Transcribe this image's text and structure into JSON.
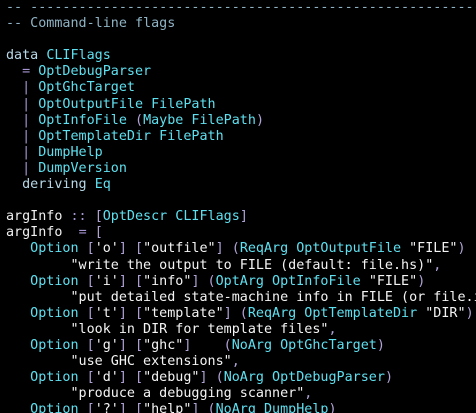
{
  "editor": {
    "lines": [
      [
        {
          "t": "-- ---------------------------------------------------------",
          "c": "comment"
        }
      ],
      [
        {
          "t": "-- Command-line flags",
          "c": "comment"
        }
      ],
      [],
      [
        {
          "t": "data ",
          "c": "keyword"
        },
        {
          "t": "CLIFlags",
          "c": "type"
        }
      ],
      [
        {
          "t": "  = ",
          "c": "oper"
        },
        {
          "t": "OptDebugParser",
          "c": "type"
        }
      ],
      [
        {
          "t": "  | ",
          "c": "oper"
        },
        {
          "t": "OptGhcTarget",
          "c": "type"
        }
      ],
      [
        {
          "t": "  | ",
          "c": "oper"
        },
        {
          "t": "OptOutputFile FilePath",
          "c": "type"
        }
      ],
      [
        {
          "t": "  | ",
          "c": "oper"
        },
        {
          "t": "OptInfoFile ",
          "c": "type"
        },
        {
          "t": "(",
          "c": "punct"
        },
        {
          "t": "Maybe FilePath",
          "c": "type"
        },
        {
          "t": ")",
          "c": "punct"
        }
      ],
      [
        {
          "t": "  | ",
          "c": "oper"
        },
        {
          "t": "OptTemplateDir FilePath",
          "c": "type"
        }
      ],
      [
        {
          "t": "  | ",
          "c": "oper"
        },
        {
          "t": "DumpHelp",
          "c": "type"
        }
      ],
      [
        {
          "t": "  | ",
          "c": "oper"
        },
        {
          "t": "DumpVersion",
          "c": "type"
        }
      ],
      [
        {
          "t": "  deriving ",
          "c": "keyword"
        },
        {
          "t": "Eq",
          "c": "type"
        }
      ],
      [],
      [
        {
          "t": "argInfo ",
          "c": "plain"
        },
        {
          "t": ":: ",
          "c": "oper"
        },
        {
          "t": "[",
          "c": "punct"
        },
        {
          "t": "OptDescr CLIFlags",
          "c": "type"
        },
        {
          "t": "]",
          "c": "punct"
        }
      ],
      [
        {
          "t": "argInfo  ",
          "c": "plain"
        },
        {
          "t": "= ",
          "c": "oper"
        },
        {
          "t": "[",
          "c": "punct"
        }
      ],
      [
        {
          "t": "   Option ",
          "c": "type"
        },
        {
          "t": "[",
          "c": "punct"
        },
        {
          "t": "'o'",
          "c": "string"
        },
        {
          "t": "] [",
          "c": "punct"
        },
        {
          "t": "\"outfile\"",
          "c": "string"
        },
        {
          "t": "] (",
          "c": "punct"
        },
        {
          "t": "ReqArg OptOutputFile ",
          "c": "type"
        },
        {
          "t": "\"FILE\"",
          "c": "string"
        },
        {
          "t": ")",
          "c": "punct"
        }
      ],
      [
        {
          "t": "        \"write the output to FILE (default: file.hs)\"",
          "c": "string"
        },
        {
          "t": ",",
          "c": "punct"
        }
      ],
      [
        {
          "t": "   Option ",
          "c": "type"
        },
        {
          "t": "[",
          "c": "punct"
        },
        {
          "t": "'i'",
          "c": "string"
        },
        {
          "t": "] [",
          "c": "punct"
        },
        {
          "t": "\"info\"",
          "c": "string"
        },
        {
          "t": "] (",
          "c": "punct"
        },
        {
          "t": "OptArg OptInfoFile ",
          "c": "type"
        },
        {
          "t": "\"FILE\"",
          "c": "string"
        },
        {
          "t": ")",
          "c": "punct"
        }
      ],
      [
        {
          "t": "        \"put detailed state-machine info in FILE (or file.info)\"",
          "c": "string"
        },
        {
          "t": ",",
          "c": "punct"
        }
      ],
      [
        {
          "t": "   Option ",
          "c": "type"
        },
        {
          "t": "[",
          "c": "punct"
        },
        {
          "t": "'t'",
          "c": "string"
        },
        {
          "t": "] [",
          "c": "punct"
        },
        {
          "t": "\"template\"",
          "c": "string"
        },
        {
          "t": "] (",
          "c": "punct"
        },
        {
          "t": "ReqArg OptTemplateDir ",
          "c": "type"
        },
        {
          "t": "\"DIR\"",
          "c": "string"
        },
        {
          "t": ")",
          "c": "punct"
        }
      ],
      [
        {
          "t": "        \"look in DIR for template files\"",
          "c": "string"
        },
        {
          "t": ",",
          "c": "punct"
        }
      ],
      [
        {
          "t": "   Option ",
          "c": "type"
        },
        {
          "t": "[",
          "c": "punct"
        },
        {
          "t": "'g'",
          "c": "string"
        },
        {
          "t": "] [",
          "c": "punct"
        },
        {
          "t": "\"ghc\"",
          "c": "string"
        },
        {
          "t": "]    (",
          "c": "punct"
        },
        {
          "t": "NoArg OptGhcTarget",
          "c": "type"
        },
        {
          "t": ")",
          "c": "punct"
        }
      ],
      [
        {
          "t": "        \"use GHC extensions\"",
          "c": "string"
        },
        {
          "t": ",",
          "c": "punct"
        }
      ],
      [
        {
          "t": "   Option ",
          "c": "type"
        },
        {
          "t": "[",
          "c": "punct"
        },
        {
          "t": "'d'",
          "c": "string"
        },
        {
          "t": "] [",
          "c": "punct"
        },
        {
          "t": "\"debug\"",
          "c": "string"
        },
        {
          "t": "] (",
          "c": "punct"
        },
        {
          "t": "NoArg OptDebugParser",
          "c": "type"
        },
        {
          "t": ")",
          "c": "punct"
        }
      ],
      [
        {
          "t": "        \"produce a debugging scanner\"",
          "c": "string"
        },
        {
          "t": ",",
          "c": "punct"
        }
      ],
      [
        {
          "t": "   Option ",
          "c": "type"
        },
        {
          "t": "[",
          "c": "punct"
        },
        {
          "t": "'?'",
          "c": "string"
        },
        {
          "t": "] [",
          "c": "punct"
        },
        {
          "t": "\"help\"",
          "c": "string"
        },
        {
          "t": "] (",
          "c": "punct"
        },
        {
          "t": "NoArg DumpHelp",
          "c": "type"
        },
        {
          "t": ")",
          "c": "punct"
        }
      ]
    ]
  }
}
